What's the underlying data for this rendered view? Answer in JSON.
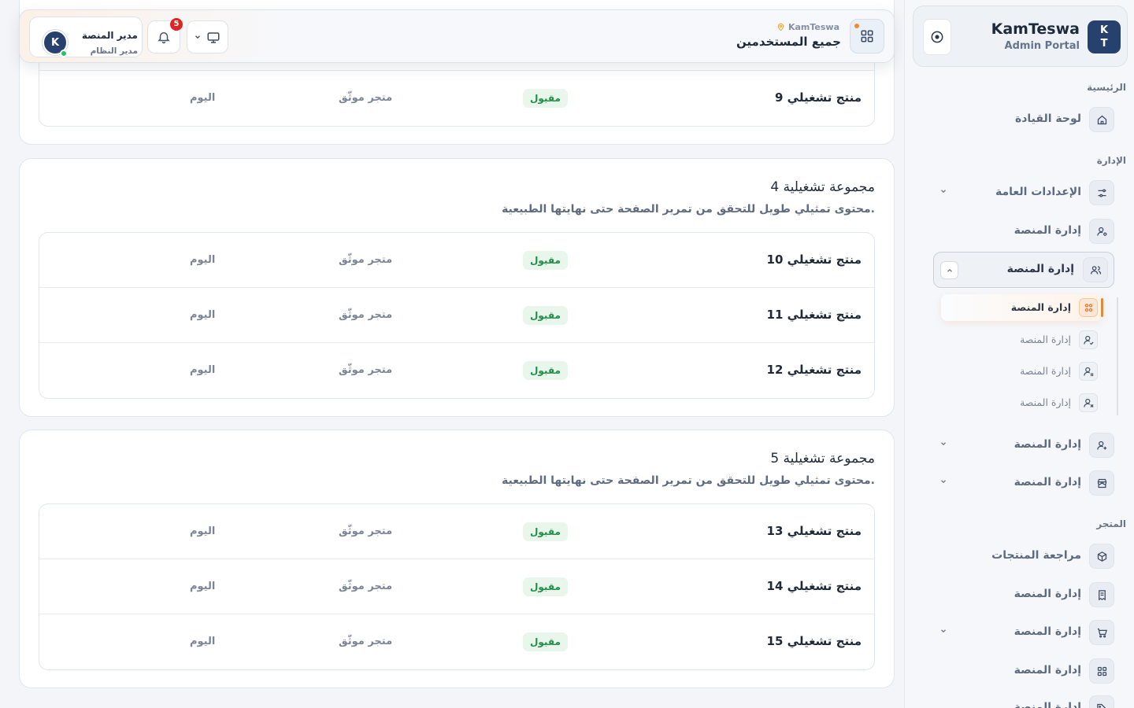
{
  "brand": {
    "logo_line1": "K",
    "logo_line2": "T",
    "name": "KamTeswa",
    "subtitle": "Admin Portal"
  },
  "sidebar": {
    "sections": [
      {
        "title": "الرئيسية"
      },
      {
        "title": "الإدارة"
      },
      {
        "title": "المتجر"
      }
    ],
    "items": [
      {
        "label": "لوحة القيادة",
        "icon": "home-icon"
      },
      {
        "label": "الإعدادات العامة",
        "icon": "sliders-icon",
        "chevron": "down"
      },
      {
        "label": "إدارة المنصة",
        "icon": "user-cog-icon"
      },
      {
        "label": "إدارة المنصة",
        "icon": "users-icon",
        "chevron": "up",
        "expanded": true
      },
      {
        "label": "إدارة المنصة",
        "icon": "user-plus-icon",
        "chevron": "down"
      },
      {
        "label": "إدارة المنصة",
        "icon": "store-icon",
        "chevron": "down"
      },
      {
        "label": "مراجعة المنتجات",
        "icon": "box-icon"
      },
      {
        "label": "إدارة المنصة",
        "icon": "receipt-icon"
      },
      {
        "label": "إدارة المنصة",
        "icon": "cart-icon",
        "chevron": "down"
      },
      {
        "label": "إدارة المنصة",
        "icon": "apps-icon"
      },
      {
        "label": "إدارة المنصة",
        "icon": "tag-icon"
      }
    ],
    "subitems": [
      {
        "label": "إدارة المنصة",
        "icon": "user-group-icon",
        "active": true
      },
      {
        "label": "إدارة المنصة",
        "icon": "user-check-icon"
      },
      {
        "label": "إدارة المنصة",
        "icon": "user-pause-icon"
      },
      {
        "label": "إدارة المنصة",
        "icon": "user-x-icon"
      }
    ]
  },
  "header": {
    "breadcrumb": "KamTeswa",
    "title": "جميع المستخدمين",
    "notifications_count": "5",
    "user": {
      "avatar": "K",
      "name": "مدير المنصة",
      "role": "مدير النظام"
    },
    "accent": "#ef8a2e"
  },
  "groups": [
    {
      "title": "",
      "description": "",
      "rows": [
        {
          "name": "منتج تشغيلي 9",
          "status": "مقبول",
          "store": "متجر موثّق",
          "date": "اليوم"
        }
      ]
    },
    {
      "title": "مجموعة تشغيلية 4",
      "description": "محتوى تمثيلي طويل للتحقق من تمرير الصفحة حتى نهايتها الطبيعية.",
      "rows": [
        {
          "name": "منتج تشغيلي 10",
          "status": "مقبول",
          "store": "متجر موثّق",
          "date": "اليوم"
        },
        {
          "name": "منتج تشغيلي 11",
          "status": "مقبول",
          "store": "متجر موثّق",
          "date": "اليوم"
        },
        {
          "name": "منتج تشغيلي 12",
          "status": "مقبول",
          "store": "متجر موثّق",
          "date": "اليوم"
        }
      ]
    },
    {
      "title": "مجموعة تشغيلية 5",
      "description": "محتوى تمثيلي طويل للتحقق من تمرير الصفحة حتى نهايتها الطبيعية.",
      "rows": [
        {
          "name": "منتج تشغيلي 13",
          "status": "مقبول",
          "store": "متجر موثّق",
          "date": "اليوم"
        },
        {
          "name": "منتج تشغيلي 14",
          "status": "مقبول",
          "store": "متجر موثّق",
          "date": "اليوم"
        },
        {
          "name": "منتج تشغيلي 15",
          "status": "مقبول",
          "store": "متجر موثّق",
          "date": "اليوم"
        }
      ]
    }
  ],
  "colors": {
    "brand": "#27416e",
    "status_accepted": "#1f8f47",
    "status_bg": "#e8f6ec",
    "badge": "#e02424",
    "active_accent": "#e18b3d"
  }
}
